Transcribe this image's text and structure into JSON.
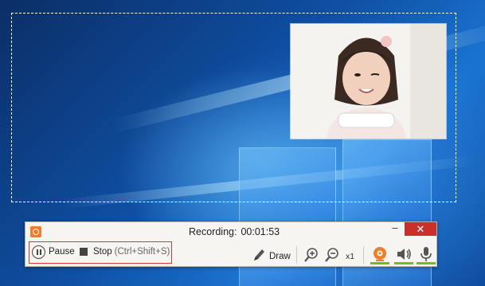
{
  "recorder": {
    "status_label": "Recording:",
    "elapsed_time": "00:01:53",
    "minimize_glyph": "–",
    "close_glyph": "✕"
  },
  "controls": {
    "pause_label": "Pause",
    "stop_label": "Stop",
    "stop_shortcut": "(Ctrl+Shift+S)",
    "draw_label": "Draw",
    "zoom_level": "x1"
  },
  "icons": [
    "app-logo-icon",
    "pause-icon",
    "stop-icon",
    "pen-icon",
    "zoom-in-icon",
    "zoom-out-icon",
    "webcam-icon",
    "speaker-icon",
    "microphone-icon"
  ],
  "colors": {
    "accent_orange": "#f07d2a",
    "recording_highlight": "#d23a3a",
    "active_indicator": "#6bbf1e",
    "close_button": "#c9302c"
  }
}
